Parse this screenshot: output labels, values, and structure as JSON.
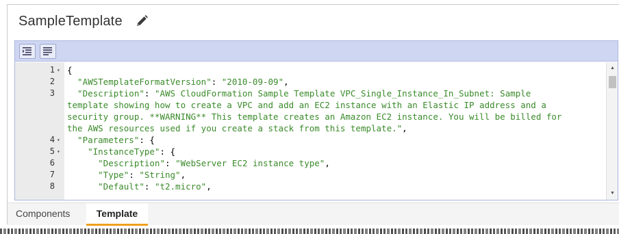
{
  "template": {
    "title": "SampleTemplate",
    "edit_icon": "pencil-icon"
  },
  "toolbar": {
    "buttons": [
      {
        "icon": "format-indent-icon",
        "name": "Format code"
      },
      {
        "icon": "wrap-lines-icon",
        "name": "Toggle word wrap"
      }
    ]
  },
  "editor": {
    "lines": [
      {
        "num": "1",
        "fold": true,
        "tokens": [
          {
            "t": "{",
            "c": "pun"
          }
        ]
      },
      {
        "num": "2",
        "fold": false,
        "tokens": [
          {
            "t": "  \"AWSTemplateFormatVersion\"",
            "c": "str"
          },
          {
            "t": ": ",
            "c": "pun"
          },
          {
            "t": "\"2010-09-09\"",
            "c": "str"
          },
          {
            "t": ",",
            "c": "pun"
          }
        ]
      },
      {
        "num": "3",
        "fold": false,
        "tokens": [
          {
            "t": "  \"Description\"",
            "c": "str"
          },
          {
            "t": ": ",
            "c": "pun"
          },
          {
            "t": "\"AWS CloudFormation Sample Template VPC_Single_Instance_In_Subnet: Sample",
            "c": "str"
          }
        ]
      },
      {
        "num": "",
        "fold": false,
        "tokens": [
          {
            "t": "template showing how to create a VPC and add an EC2 instance with an Elastic IP address and a",
            "c": "str"
          }
        ]
      },
      {
        "num": "",
        "fold": false,
        "tokens": [
          {
            "t": "security group. **WARNING** This template creates an Amazon EC2 instance. You will be billed for",
            "c": "str"
          }
        ]
      },
      {
        "num": "",
        "fold": false,
        "tokens": [
          {
            "t": "the AWS resources used if you create a stack from this template.\"",
            "c": "str"
          },
          {
            "t": ",",
            "c": "pun"
          }
        ]
      },
      {
        "num": "4",
        "fold": true,
        "tokens": [
          {
            "t": "  \"Parameters\"",
            "c": "str"
          },
          {
            "t": ": {",
            "c": "pun"
          }
        ]
      },
      {
        "num": "5",
        "fold": true,
        "tokens": [
          {
            "t": "    \"InstanceType\"",
            "c": "str"
          },
          {
            "t": ": {",
            "c": "pun"
          }
        ]
      },
      {
        "num": "6",
        "fold": false,
        "tokens": [
          {
            "t": "      \"Description\"",
            "c": "str"
          },
          {
            "t": ": ",
            "c": "pun"
          },
          {
            "t": "\"WebServer EC2 instance type\"",
            "c": "str"
          },
          {
            "t": ",",
            "c": "pun"
          }
        ]
      },
      {
        "num": "7",
        "fold": false,
        "tokens": [
          {
            "t": "      \"Type\"",
            "c": "str"
          },
          {
            "t": ": ",
            "c": "pun"
          },
          {
            "t": "\"String\"",
            "c": "str"
          },
          {
            "t": ",",
            "c": "pun"
          }
        ]
      },
      {
        "num": "8",
        "fold": false,
        "tokens": [
          {
            "t": "      \"Default\"",
            "c": "str"
          },
          {
            "t": ": ",
            "c": "pun"
          },
          {
            "t": "\"t2.micro\"",
            "c": "str"
          },
          {
            "t": ",",
            "c": "pun"
          }
        ]
      }
    ]
  },
  "scrollbar": {
    "up_icon": "scroll-up-arrow-icon",
    "down_icon": "scroll-down-arrow-icon"
  },
  "tabs": [
    {
      "label": "Components",
      "active": false
    },
    {
      "label": "Template",
      "active": true
    }
  ],
  "colors": {
    "string": "#3a8a2a",
    "toolbar": "#cfd6f2",
    "active_tab_underline": "#f0a020",
    "gutter": "#ebebeb"
  }
}
